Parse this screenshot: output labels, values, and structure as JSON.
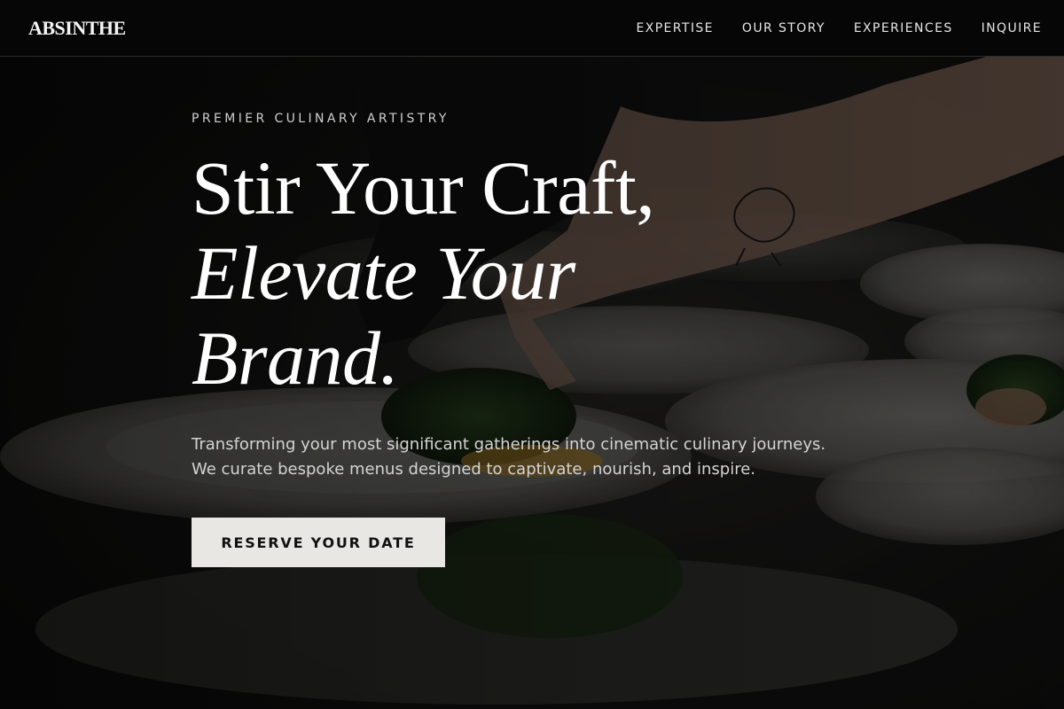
{
  "brand": {
    "logo_text": "ABSINTHE"
  },
  "nav": {
    "items": [
      {
        "label": "EXPERTISE"
      },
      {
        "label": "OUR STORY"
      },
      {
        "label": "EXPERIENCES"
      },
      {
        "label": "INQUIRE"
      }
    ]
  },
  "hero": {
    "eyebrow": "PREMIER CULINARY ARTISTRY",
    "headline_line1": "Stir Your Craft,",
    "headline_line2": "Elevate Your",
    "headline_line3": "Brand.",
    "description": "Transforming your most significant gatherings into cinematic culinary journeys. We curate bespoke menus designed to captivate, nourish, and inspire.",
    "cta_label": "RESERVE YOUR DATE",
    "background_image": "chef-plating-dishes-photo"
  },
  "colors": {
    "nav_background": "#060606",
    "cta_background": "#e8e7e4",
    "cta_text": "#111111",
    "headline": "#ffffff",
    "body_text": "#d4d4d4"
  }
}
